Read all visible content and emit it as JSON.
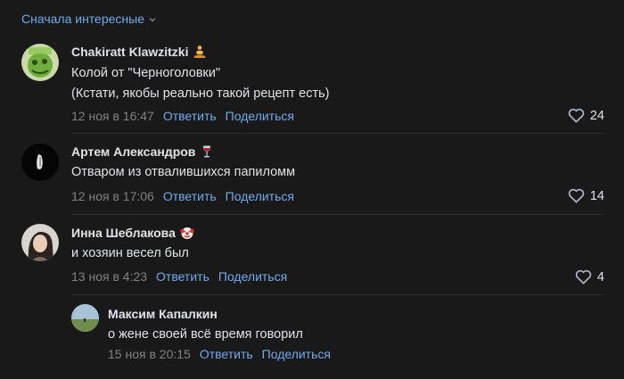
{
  "sort": {
    "label": "Сначала интересные"
  },
  "actions": {
    "reply": "Ответить",
    "share": "Поделиться"
  },
  "comments": [
    {
      "author": "Chakiratt Klawzitzki",
      "lines": [
        "Колой от \"Черноголовки\"",
        "(Кстати, якобы реально такой рецепт есть)"
      ],
      "time": "12 ноя в 16:47",
      "likes": "24",
      "emoji": "meditating-person-icon"
    },
    {
      "author": "Артем Александров",
      "lines": [
        "Отваром из отвалившихся папиломм"
      ],
      "time": "12 ноя в 17:06",
      "likes": "14",
      "emoji": "wine-glass-icon"
    },
    {
      "author": "Инна Шеблакова",
      "lines": [
        "и хозяин весел был"
      ],
      "time": "13 ноя в 4:23",
      "likes": "4",
      "emoji": "clown-face-icon"
    },
    {
      "author": "Максим Капалкин",
      "lines": [
        "о жене своей всё время говорил"
      ],
      "time": "15 ноя в 20:15"
    }
  ],
  "colors": {
    "background": "#19191a",
    "link": "#71aaeb",
    "muted": "#828282",
    "text": "#e1e3e6"
  }
}
